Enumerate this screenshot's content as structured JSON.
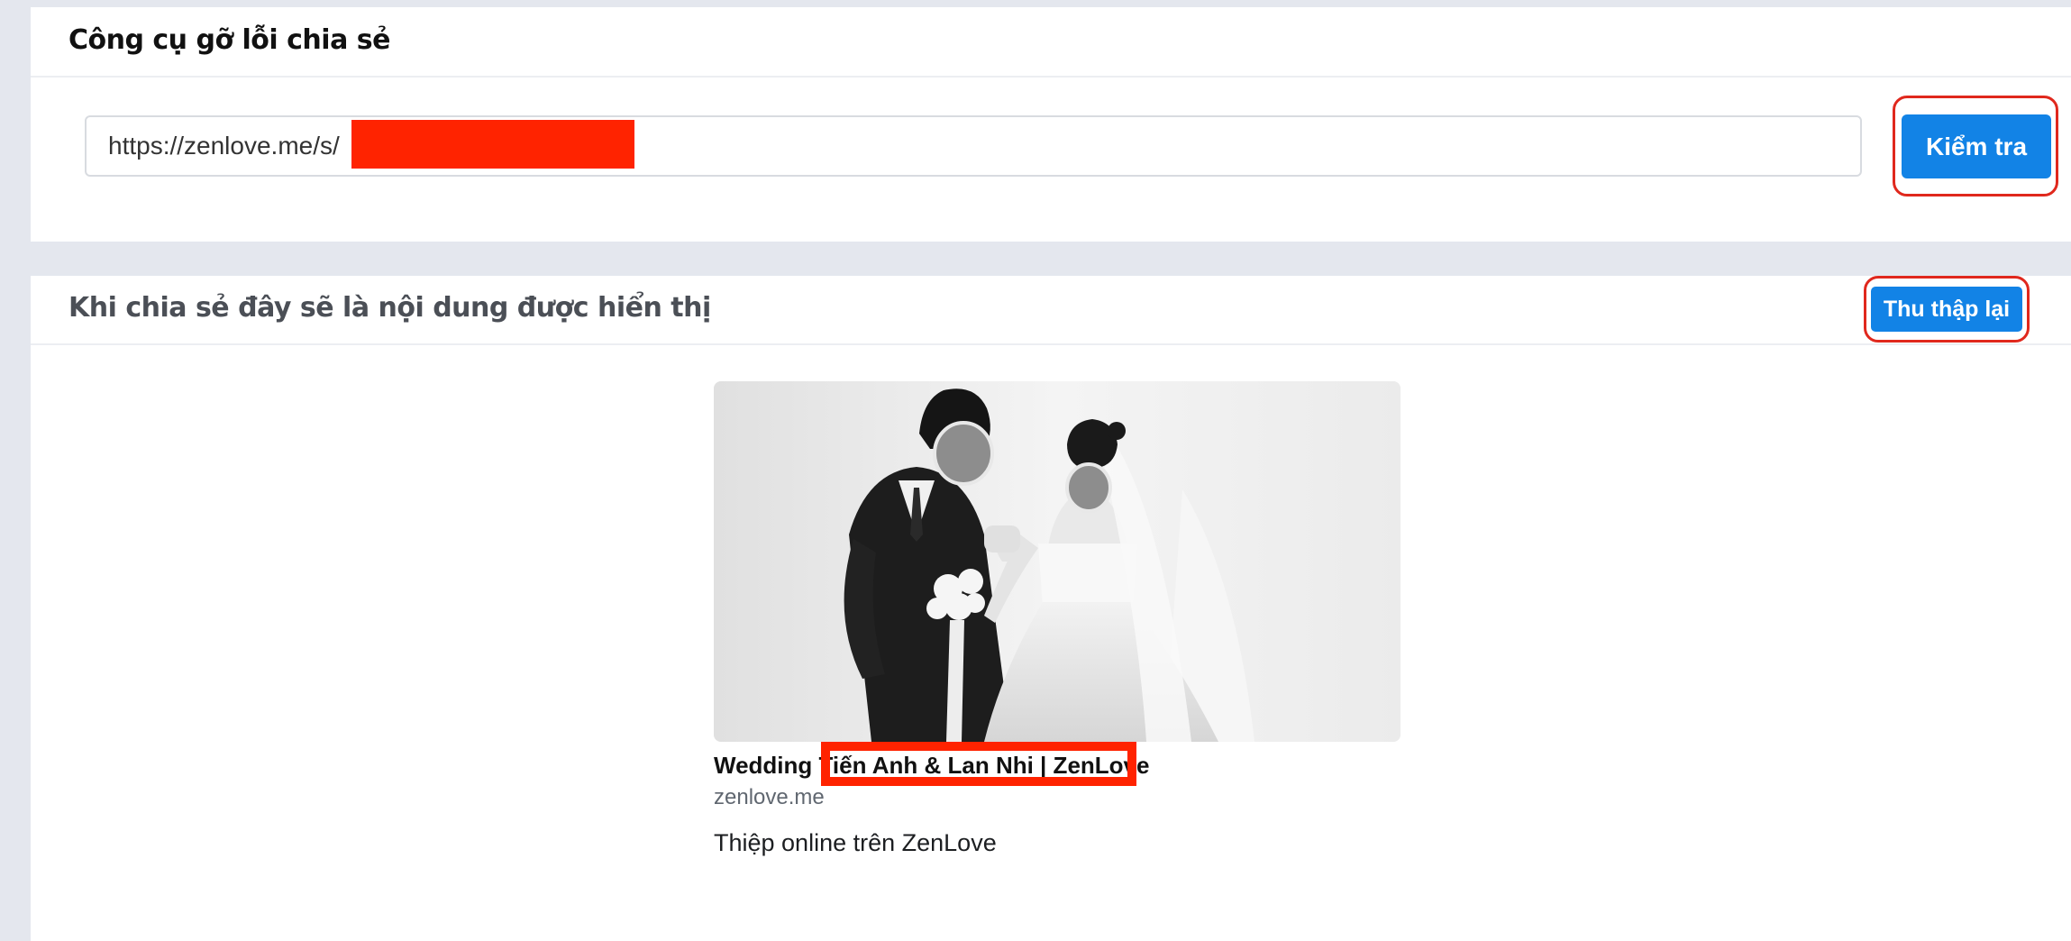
{
  "debugger": {
    "title": "Công cụ gỡ lỗi chia sẻ",
    "url_value": "https://zenlove.me/s/",
    "check_button": "Kiểm tra"
  },
  "preview": {
    "title": "Khi chia sẻ đây sẽ là nội dung được hiển thị",
    "rescrape_button": "Thu thập lại",
    "card": {
      "image_alt": "Wedding photo",
      "title": "Wedding Tiến Anh & Lan Nhi | ZenLove",
      "domain": "zenlove.me",
      "description": "Thiệp online trên ZenLove"
    }
  },
  "colors": {
    "accent": "#1283e6",
    "redaction": "#ff2300",
    "highlight": "#e0281d",
    "background": "#e4e7ee"
  }
}
